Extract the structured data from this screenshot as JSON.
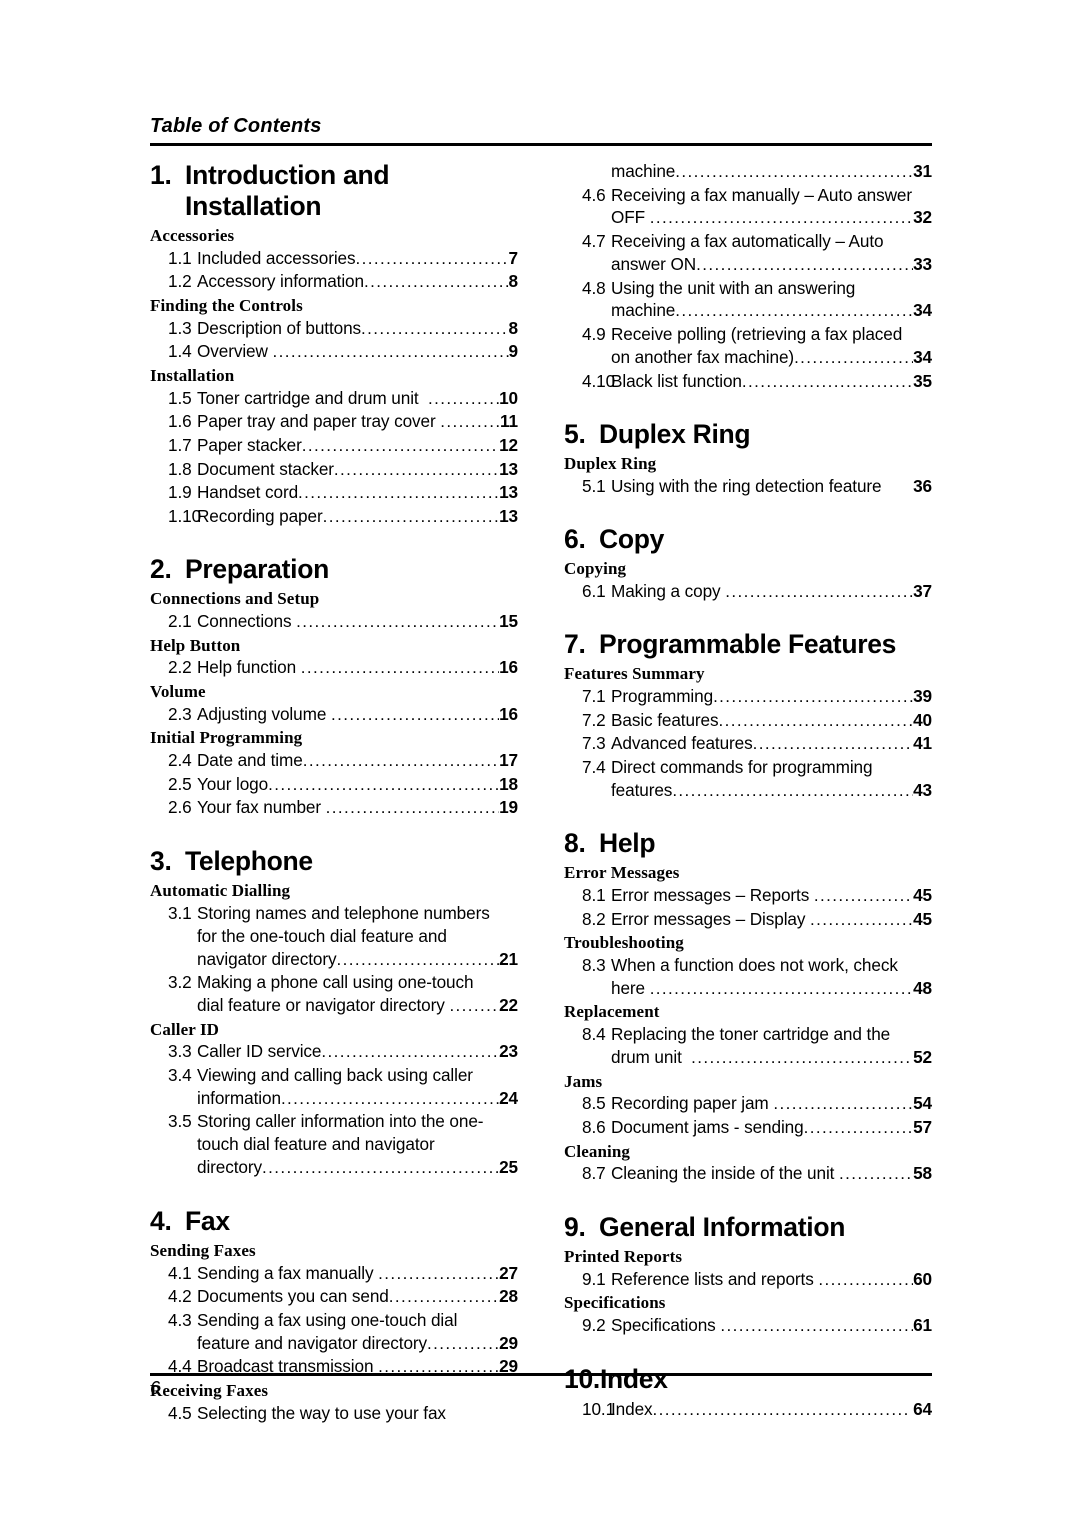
{
  "header": {
    "title": "Table of Contents"
  },
  "footer": {
    "page_number": "6"
  },
  "columns": {
    "left": [
      {
        "type": "chapter",
        "number": "1.",
        "title": "Introduction and Installation"
      },
      {
        "type": "group",
        "label": "Accessories"
      },
      {
        "type": "entry",
        "number": "1.1",
        "text": "Included accessories",
        "page": "7"
      },
      {
        "type": "entry",
        "number": "1.2",
        "text": "Accessory information",
        "page": "8"
      },
      {
        "type": "group",
        "label": "Finding the Controls"
      },
      {
        "type": "entry",
        "number": "1.3",
        "text": "Description of buttons",
        "page": "8"
      },
      {
        "type": "entry",
        "number": "1.4",
        "text": "Overview ",
        "page": "9"
      },
      {
        "type": "group",
        "label": "Installation"
      },
      {
        "type": "entry",
        "number": "1.5",
        "text": "Toner cartridge and drum unit  ",
        "page": "10"
      },
      {
        "type": "entry",
        "number": "1.6",
        "text": "Paper tray and paper tray cover ",
        "page": "11"
      },
      {
        "type": "entry",
        "number": "1.7",
        "text": "Paper stacker",
        "page": "12"
      },
      {
        "type": "entry",
        "number": "1.8",
        "text": "Document stacker",
        "page": "13"
      },
      {
        "type": "entry",
        "number": "1.9",
        "text": "Handset cord",
        "page": "13"
      },
      {
        "type": "entry",
        "number": "1.10",
        "text": "Recording paper",
        "page": "13"
      },
      {
        "type": "chapter",
        "number": "2.",
        "title": "Preparation"
      },
      {
        "type": "group",
        "label": "Connections and Setup"
      },
      {
        "type": "entry",
        "number": "2.1",
        "text": "Connections ",
        "page": "15"
      },
      {
        "type": "group",
        "label": "Help Button"
      },
      {
        "type": "entry",
        "number": "2.2",
        "text": "Help function ",
        "page": "16"
      },
      {
        "type": "group",
        "label": "Volume"
      },
      {
        "type": "entry",
        "number": "2.3",
        "text": "Adjusting volume ",
        "page": "16"
      },
      {
        "type": "group",
        "label": "Initial Programming"
      },
      {
        "type": "entry",
        "number": "2.4",
        "text": "Date and time",
        "page": "17"
      },
      {
        "type": "entry",
        "number": "2.5",
        "text": "Your logo",
        "page": "18"
      },
      {
        "type": "entry",
        "number": "2.6",
        "text": "Your fax number ",
        "page": "19"
      },
      {
        "type": "chapter",
        "number": "3.",
        "title": "Telephone"
      },
      {
        "type": "group",
        "label": "Automatic Dialling"
      },
      {
        "type": "entry",
        "number": "3.1",
        "lines": [
          "Storing names and telephone numbers",
          "for the one-touch dial feature and"
        ],
        "text": "navigator directory",
        "page": "21"
      },
      {
        "type": "entry",
        "number": "3.2",
        "lines": [
          "Making a phone call using one-touch"
        ],
        "text": "dial feature or navigator directory ",
        "page": "22"
      },
      {
        "type": "group",
        "label": "Caller ID"
      },
      {
        "type": "entry",
        "number": "3.3",
        "text": "Caller ID service",
        "page": "23"
      },
      {
        "type": "entry",
        "number": "3.4",
        "lines": [
          "Viewing and calling back using caller"
        ],
        "text": "information",
        "page": "24"
      },
      {
        "type": "entry",
        "number": "3.5",
        "lines": [
          "Storing caller information into the one-",
          "touch dial feature and navigator"
        ],
        "text": "directory",
        "page": "25"
      },
      {
        "type": "chapter",
        "number": "4.",
        "title": "Fax"
      },
      {
        "type": "group",
        "label": "Sending Faxes"
      },
      {
        "type": "entry",
        "number": "4.1",
        "text": "Sending a fax manually ",
        "page": "27"
      },
      {
        "type": "entry",
        "number": "4.2",
        "text": "Documents you can send",
        "page": "28"
      },
      {
        "type": "entry",
        "number": "4.3",
        "lines": [
          "Sending a fax using one-touch dial"
        ],
        "text": "feature and navigator directory",
        "page": "29"
      },
      {
        "type": "entry",
        "number": "4.4",
        "text": "Broadcast transmission ",
        "page": "29"
      },
      {
        "type": "group",
        "label": "Receiving Faxes"
      },
      {
        "type": "entry",
        "number": "4.5",
        "lines": [
          "Selecting the way to use your fax"
        ],
        "text": "",
        "page": "",
        "nodots": true
      }
    ],
    "right": [
      {
        "type": "entry",
        "number": "",
        "text": "machine",
        "page": "31"
      },
      {
        "type": "entry",
        "number": "4.6",
        "lines": [
          "Receiving a fax manually – Auto answer"
        ],
        "text": "OFF ",
        "page": "32"
      },
      {
        "type": "entry",
        "number": "4.7",
        "lines": [
          "Receiving a fax automatically – Auto"
        ],
        "text": "answer ON",
        "page": "33"
      },
      {
        "type": "entry",
        "number": "4.8",
        "lines": [
          "Using the unit with an answering"
        ],
        "text": "machine",
        "page": "34"
      },
      {
        "type": "entry",
        "number": "4.9",
        "lines": [
          "Receive polling (retrieving a fax placed"
        ],
        "text": "on another fax machine)",
        "page": "34"
      },
      {
        "type": "entry",
        "number": "4.10",
        "text": "Black list function",
        "page": "35"
      },
      {
        "type": "chapter",
        "number": "5.",
        "title": "Duplex Ring"
      },
      {
        "type": "group",
        "label": "Duplex Ring"
      },
      {
        "type": "entry",
        "number": "5.1",
        "text": "Using with the ring detection feature",
        "page": "36",
        "nodots": true
      },
      {
        "type": "chapter",
        "number": "6.",
        "title": "Copy"
      },
      {
        "type": "group",
        "label": "Copying"
      },
      {
        "type": "entry",
        "number": "6.1",
        "text": "Making a copy ",
        "page": "37"
      },
      {
        "type": "chapter",
        "number": "7.",
        "title": "Programmable Features"
      },
      {
        "type": "group",
        "label": "Features Summary"
      },
      {
        "type": "entry",
        "number": "7.1",
        "text": "Programming",
        "page": "39"
      },
      {
        "type": "entry",
        "number": "7.2",
        "text": "Basic features",
        "page": "40"
      },
      {
        "type": "entry",
        "number": "7.3",
        "text": "Advanced features",
        "page": "41"
      },
      {
        "type": "entry",
        "number": "7.4",
        "lines": [
          "Direct commands for programming"
        ],
        "text": "features",
        "page": "43"
      },
      {
        "type": "chapter",
        "number": "8.",
        "title": "Help"
      },
      {
        "type": "group",
        "label": "Error Messages"
      },
      {
        "type": "entry",
        "number": "8.1",
        "text": "Error messages – Reports ",
        "page": "45"
      },
      {
        "type": "entry",
        "number": "8.2",
        "text": "Error messages – Display ",
        "page": "45"
      },
      {
        "type": "group",
        "label": "Troubleshooting"
      },
      {
        "type": "entry",
        "number": "8.3",
        "lines": [
          "When a function does not work, check"
        ],
        "text": "here ",
        "page": "48"
      },
      {
        "type": "group",
        "label": "Replacement"
      },
      {
        "type": "entry",
        "number": "8.4",
        "lines": [
          "Replacing the toner cartridge and the"
        ],
        "text": "drum unit  ",
        "page": "52"
      },
      {
        "type": "group",
        "label": "Jams"
      },
      {
        "type": "entry",
        "number": "8.5",
        "text": "Recording paper jam ",
        "page": "54"
      },
      {
        "type": "entry",
        "number": "8.6",
        "text": "Document jams - sending",
        "page": "57"
      },
      {
        "type": "group",
        "label": "Cleaning"
      },
      {
        "type": "entry",
        "number": "8.7",
        "text": "Cleaning the inside of the unit ",
        "page": "58"
      },
      {
        "type": "chapter",
        "number": "9.",
        "title": "General Information"
      },
      {
        "type": "group",
        "label": "Printed Reports"
      },
      {
        "type": "entry",
        "number": "9.1",
        "text": "Reference lists and reports ",
        "page": "60"
      },
      {
        "type": "group",
        "label": "Specifications"
      },
      {
        "type": "entry",
        "number": "9.2",
        "text": "Specifications ",
        "page": "61"
      },
      {
        "type": "chapter",
        "number": "10.",
        "title": "Index",
        "tight": true
      },
      {
        "type": "entry",
        "number": "10.1",
        "text": "Index",
        "page": "64",
        "spacedPage": true
      }
    ]
  }
}
